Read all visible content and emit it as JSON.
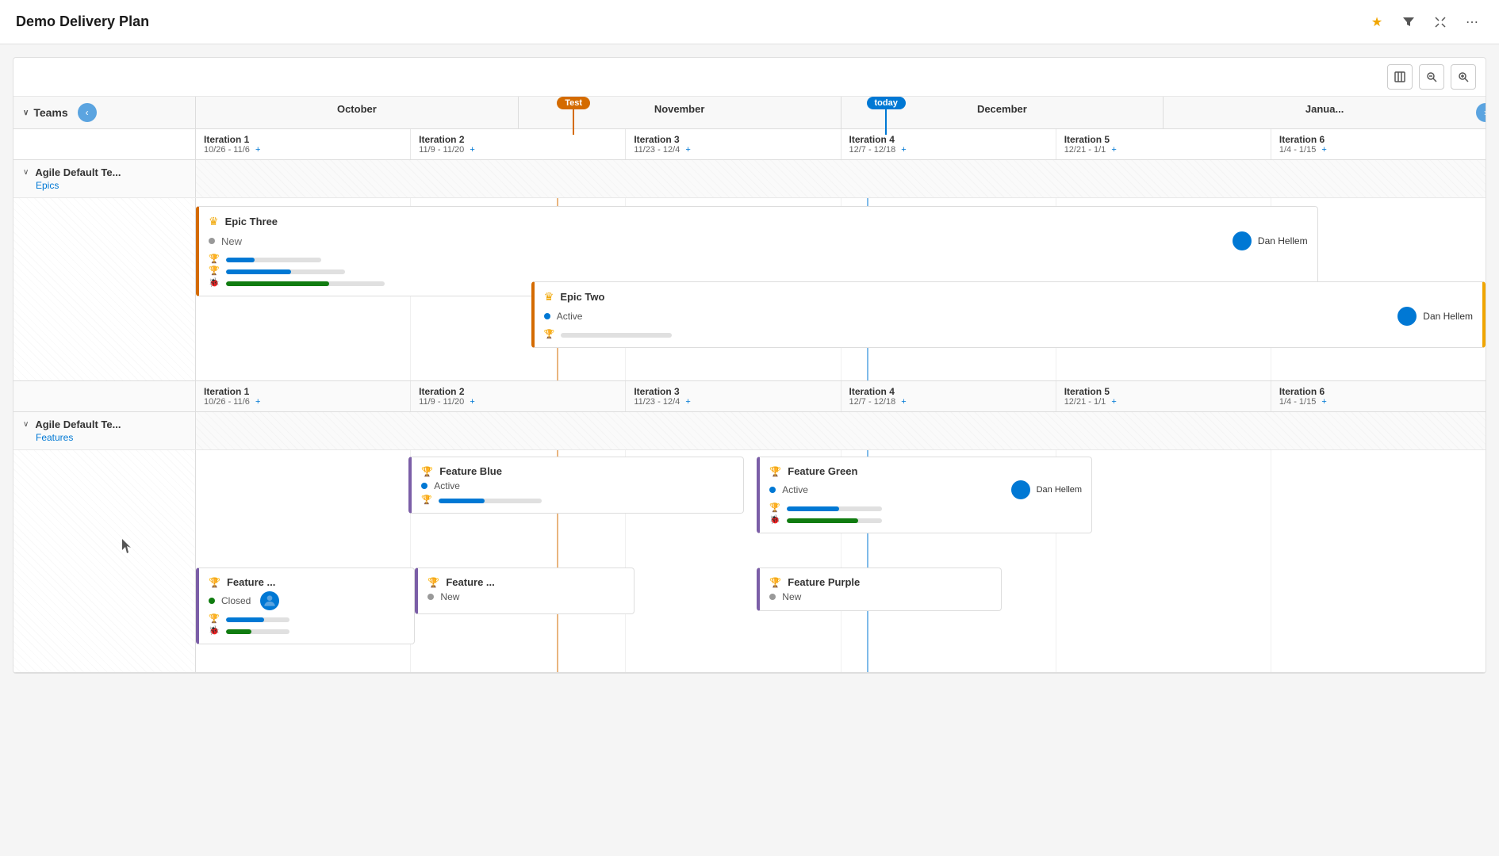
{
  "header": {
    "title": "Demo Delivery Plan",
    "icons": {
      "star": "★",
      "filter": "⊘",
      "collapse": "⤡",
      "more": "⋯"
    }
  },
  "toolbar": {
    "fit_icon": "⊞",
    "zoom_out": "🔍",
    "zoom_in": "🔍"
  },
  "timeline": {
    "months": [
      "October",
      "November",
      "December",
      "Janua..."
    ],
    "today_label": "today",
    "test_label": "Test",
    "teams_label": "Teams"
  },
  "team1": {
    "name": "Agile Default Te...",
    "type": "Epics",
    "iterations": [
      {
        "name": "Iteration 1",
        "dates": "10/26 - 11/6"
      },
      {
        "name": "Iteration 2",
        "dates": "11/9 - 11/20"
      },
      {
        "name": "Iteration 3",
        "dates": "11/23 - 12/4"
      },
      {
        "name": "Iteration 4",
        "dates": "12/7 - 12/18"
      },
      {
        "name": "Iteration 5",
        "dates": "12/21 - 1/1"
      },
      {
        "name": "Iteration 6",
        "dates": "1/4 - 1/15"
      }
    ],
    "epics": [
      {
        "id": "epic-three",
        "title": "Epic Three",
        "status": "New",
        "status_type": "gray",
        "assignee": "Dan Hellem",
        "left_pct": 0,
        "width_pct": 90,
        "bars": [
          {
            "type": "trophy",
            "fill_pct": 30,
            "color": "blue"
          },
          {
            "type": "trophy",
            "fill_pct": 55,
            "color": "blue"
          },
          {
            "type": "bug",
            "fill_pct": 65,
            "color": "green"
          }
        ]
      },
      {
        "id": "epic-two",
        "title": "Epic Two",
        "status": "Active",
        "status_type": "blue",
        "assignee": "Dan Hellem",
        "left_pct": 27,
        "width_pct": 73,
        "bars": [
          {
            "type": "trophy",
            "fill_pct": 0,
            "color": "blue"
          }
        ]
      }
    ]
  },
  "team2": {
    "name": "Agile Default Te...",
    "type": "Features",
    "iterations": [
      {
        "name": "Iteration 1",
        "dates": "10/26 - 11/6"
      },
      {
        "name": "Iteration 2",
        "dates": "11/9 - 11/20"
      },
      {
        "name": "Iteration 3",
        "dates": "11/23 - 12/4"
      },
      {
        "name": "Iteration 4",
        "dates": "12/7 - 12/18"
      },
      {
        "name": "Iteration 5",
        "dates": "12/21 - 1/1"
      },
      {
        "name": "Iteration 6",
        "dates": "1/4 - 1/15"
      }
    ],
    "features": [
      {
        "id": "feature-blue",
        "title": "Feature Blue",
        "status": "Active",
        "status_type": "blue",
        "assignee": null,
        "col": 1,
        "row": 0,
        "bars": [
          {
            "type": "trophy",
            "fill_pct": 45,
            "color": "blue"
          }
        ]
      },
      {
        "id": "feature-green",
        "title": "Feature Green",
        "status": "Active",
        "status_type": "blue",
        "assignee": "Dan Hellem",
        "col": 2,
        "row": 0,
        "bars": [
          {
            "type": "trophy",
            "fill_pct": 55,
            "color": "blue"
          },
          {
            "type": "bug",
            "fill_pct": 75,
            "color": "green"
          }
        ]
      },
      {
        "id": "feature-closed",
        "title": "Feature ...",
        "status": "Closed",
        "status_type": "green",
        "assignee": "avatar",
        "col": 0,
        "row": 1,
        "bars": [
          {
            "type": "trophy",
            "fill_pct": 60,
            "color": "blue"
          },
          {
            "type": "bug",
            "fill_pct": 40,
            "color": "green"
          }
        ]
      },
      {
        "id": "feature-new2",
        "title": "Feature ...",
        "status": "New",
        "status_type": "gray",
        "assignee": null,
        "col": 1,
        "row": 1,
        "bars": []
      },
      {
        "id": "feature-purple",
        "title": "Feature Purple",
        "status": "New",
        "status_type": "gray",
        "assignee": null,
        "col": 2,
        "row": 1,
        "bars": []
      }
    ]
  },
  "colors": {
    "orange": "#d46b00",
    "blue": "#0078d4",
    "purple": "#7b5ea7",
    "green": "#107c10",
    "gray": "#999",
    "today_bg": "#0078d4",
    "test_bg": "#d46b00"
  }
}
